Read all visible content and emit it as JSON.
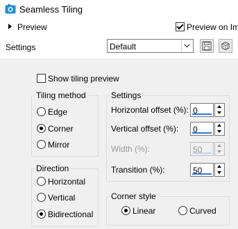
{
  "window": {
    "title": "Seamless Tiling"
  },
  "preview": {
    "label": "Preview",
    "preview_on_image_label": "Preview on Ima",
    "preview_on_image_checked": true
  },
  "settings": {
    "label": "Settings",
    "preset": "Default"
  },
  "show_tiling_preview": {
    "label": "Show tiling preview",
    "checked": false
  },
  "tiling_method": {
    "title": "Tiling method",
    "options": [
      {
        "label": "Edge",
        "selected": false
      },
      {
        "label": "Corner",
        "selected": true
      },
      {
        "label": "Mirror",
        "selected": false
      }
    ]
  },
  "direction": {
    "title": "Direction",
    "options": [
      {
        "label": "Horizontal",
        "selected": false
      },
      {
        "label": "Vertical",
        "selected": false
      },
      {
        "label": "Bidirectional",
        "selected": true
      }
    ]
  },
  "settings_group": {
    "title": "Settings",
    "fields": [
      {
        "label": "Horizontal offset (%):",
        "value": "0",
        "enabled": true
      },
      {
        "label": "Vertical offset (%):",
        "value": "0",
        "enabled": true
      },
      {
        "label": "Width (%):",
        "value": "50",
        "enabled": false
      },
      {
        "label": "Transition (%):",
        "value": "50",
        "enabled": true
      }
    ]
  },
  "corner_style": {
    "title": "Corner style",
    "options": [
      {
        "label": "Linear",
        "selected": true
      },
      {
        "label": "Curved",
        "selected": false
      }
    ]
  },
  "colors": {
    "accent": "#2b79d8",
    "panel_bg": "#f0f0f0",
    "header_bg": "#ffffff"
  }
}
